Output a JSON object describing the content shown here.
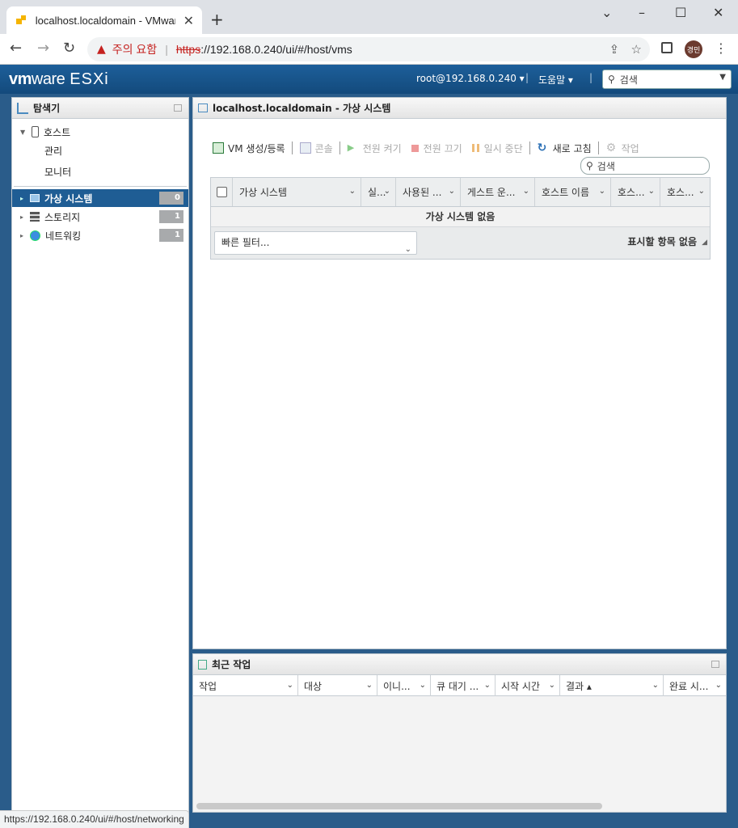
{
  "browser": {
    "tab_title": "localhost.localdomain - VMware",
    "tab_close": "✕",
    "new_tab": "+",
    "window_controls": {
      "minimize": "⌄",
      "restore": "–",
      "maximize": "☐",
      "close": "✕"
    },
    "nav": {
      "back": "←",
      "forward": "→",
      "reload": "↻"
    },
    "security_warning": "주의 요함",
    "url_scheme": "https",
    "url_rest": "://192.168.0.240/ui/#/host/vms",
    "avatar_label": "경민",
    "menu": "⋮",
    "status_url": "https://192.168.0.240/ui/#/host/networking"
  },
  "header": {
    "logo_vm": "vm",
    "logo_ware": "ware",
    "logo_product": "ESXi",
    "user": "root@192.168.0.240 ▾",
    "help": "도움말 ▾",
    "search_placeholder": "검색"
  },
  "navigator": {
    "title": "탐색기",
    "items": [
      {
        "label": "호스트",
        "expanded": true
      },
      {
        "label": "관리"
      },
      {
        "label": "모니터"
      },
      {
        "label": "가상 시스템",
        "count": "0",
        "selected": true
      },
      {
        "label": "스토리지",
        "count": "1"
      },
      {
        "label": "네트워킹",
        "count": "1"
      }
    ]
  },
  "main": {
    "title": "localhost.localdomain - 가상 시스템",
    "toolbar": {
      "create": "VM 생성/등록",
      "console": "콘솔",
      "power_on": "전원 켜기",
      "power_off": "전원 끄기",
      "suspend": "일시 중단",
      "refresh": "새로 고침",
      "actions": "작업"
    },
    "search_placeholder": "검색",
    "columns": [
      "가상 시스템",
      "실...",
      "사용된 ...",
      "게스트 운...",
      "호스트 이름",
      "호스...",
      "호스..."
    ],
    "empty_message": "가상 시스템 없음",
    "quick_filter": "빠른 필터...",
    "no_items": "표시할 항목 없음"
  },
  "tasks": {
    "title": "최근 작업",
    "columns": [
      "작업",
      "대상",
      "이니...",
      "큐 대기 ...",
      "시작 시간",
      "결과 ▴",
      "완료 시..."
    ]
  },
  "colors": {
    "header_bg": "#1d5f9a",
    "selected_nav": "#1f5d94",
    "warning_red": "#c5221f",
    "badge_gray": "#a8aaac"
  }
}
